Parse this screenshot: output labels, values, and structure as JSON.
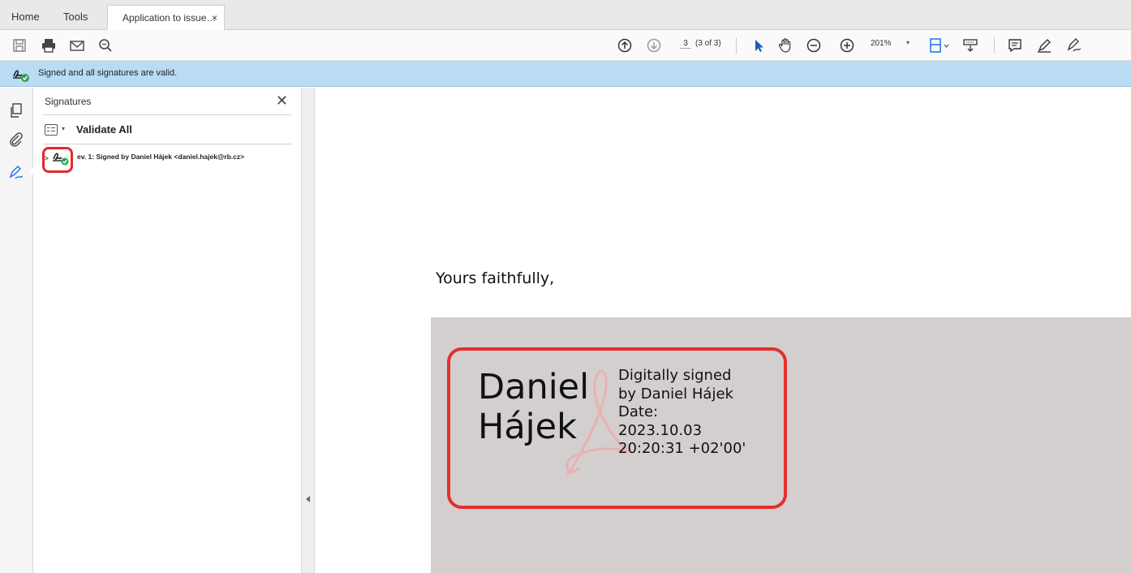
{
  "tabs": [
    {
      "label": "Home"
    },
    {
      "label": "Tools"
    },
    {
      "label": "Application to issue…",
      "close": "×"
    }
  ],
  "toolbar": {
    "page_current": "3",
    "page_of": "(3 of 3)",
    "zoom": "201%",
    "zoom_caret": "▾",
    "icons": [
      "save-icon",
      "print-icon",
      "email-icon",
      "search-icon",
      "page-up-icon",
      "page-down-icon",
      "select-cursor-icon",
      "hand-icon",
      "zoom-out-icon",
      "zoom-in-icon",
      "fit-page-icon",
      "read-mode-icon",
      "comment-icon",
      "highlight-pen-icon",
      "sign-icon"
    ]
  },
  "banner": {
    "text": "Signed and all signatures are valid."
  },
  "sidebar": {
    "panel_title": "Signatures",
    "close": "✕",
    "validate_label": "Validate All",
    "options_caret": "▾",
    "signature_item": {
      "chevron": ">",
      "label": "ev. 1: Signed by Daniel Hájek <daniel.hajek@rb.cz>"
    },
    "rail_icons": [
      "pages-icon",
      "attachment-icon",
      "signature-panel-icon"
    ]
  },
  "document": {
    "closing": "Yours faithfully,",
    "signature": {
      "name_line1": "Daniel",
      "name_line2": "Hájek",
      "details": [
        "Digitally signed",
        "by Daniel Hájek",
        "Date:",
        "2023.10.03",
        "20:20:31 +02'00'"
      ]
    }
  },
  "colors": {
    "banner_bg": "#b9dcf4",
    "highlight_red": "#e3302f",
    "signature_field_bg": "#d4cfcf",
    "valid_green": "#2ea44f",
    "accent_blue": "#1473e6"
  }
}
